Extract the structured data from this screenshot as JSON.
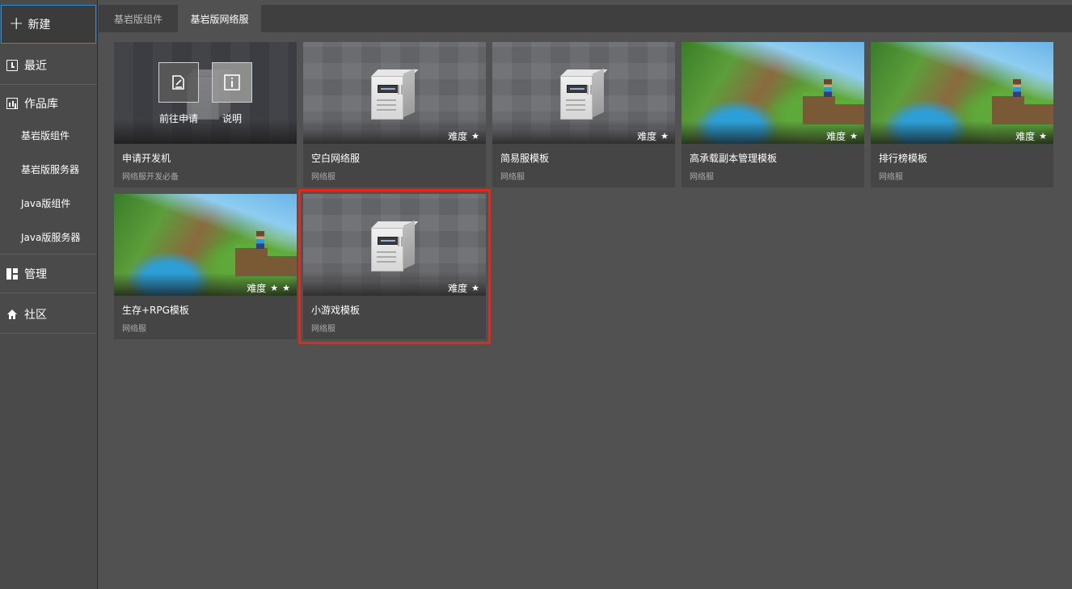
{
  "sidebar": {
    "new_label": "新建",
    "recent_label": "最近",
    "library_label": "作品库",
    "sub_items": [
      "基岩版组件",
      "基岩版服务器",
      "Java版组件",
      "Java版服务器"
    ],
    "manage_label": "管理",
    "community_label": "社区"
  },
  "tabs": [
    {
      "label": "基岩版组件",
      "active": false
    },
    {
      "label": "基岩版网络服",
      "active": true
    }
  ],
  "cards": [
    {
      "title": "申请开发机",
      "subtitle": "网络服开发必备",
      "image": "dark-server",
      "overlay": {
        "apply_label": "前往申请",
        "info_label": "说明"
      }
    },
    {
      "title": "空白网络服",
      "subtitle": "网络服",
      "image": "server",
      "difficulty_label": "难度",
      "stars": 1
    },
    {
      "title": "简易服模板",
      "subtitle": "网络服",
      "image": "server",
      "difficulty_label": "难度",
      "stars": 1
    },
    {
      "title": "高承载副本管理模板",
      "subtitle": "网络服",
      "image": "minecraft-landscape",
      "difficulty_label": "难度",
      "stars": 1
    },
    {
      "title": "排行榜模板",
      "subtitle": "网络服",
      "image": "minecraft-landscape",
      "difficulty_label": "难度",
      "stars": 1
    },
    {
      "title": "生存+RPG模板",
      "subtitle": "网络服",
      "image": "minecraft-landscape",
      "difficulty_label": "难度",
      "stars": 2
    },
    {
      "title": "小游戏模板",
      "subtitle": "网络服",
      "image": "server",
      "difficulty_label": "难度",
      "stars": 1,
      "selected": true
    }
  ],
  "colors": {
    "background": "#515151",
    "sidebar": "#4a4a4a",
    "accent_blue": "#2d8ae0",
    "selection_red": "#e8271b"
  }
}
